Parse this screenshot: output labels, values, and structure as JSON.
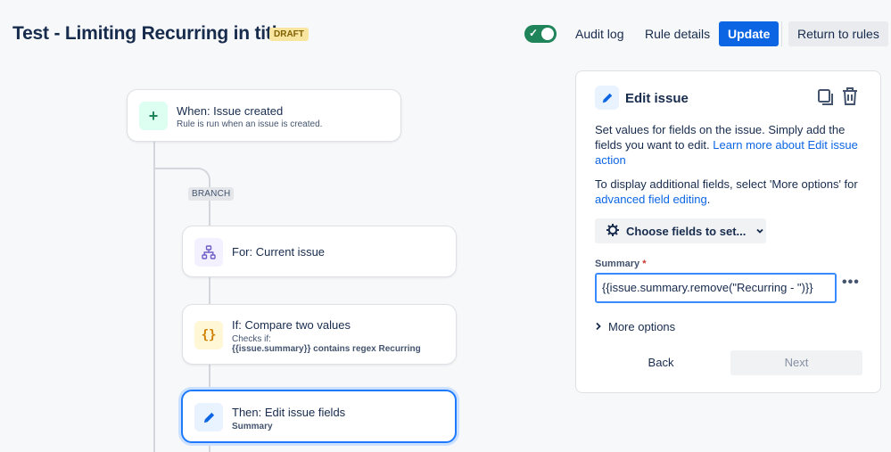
{
  "header": {
    "title": "Test - Limiting Recurring in title",
    "status_badge": "DRAFT",
    "enabled": true,
    "audit_log": "Audit log",
    "rule_details": "Rule details",
    "update": "Update",
    "return_to_rules": "Return to rules"
  },
  "flow": {
    "trigger": {
      "title": "When: Issue created",
      "subtitle": "Rule is run when an issue is created.",
      "icon": "plus-icon"
    },
    "branch_label": "BRANCH",
    "branch": {
      "title": "For: Current issue",
      "icon": "hierarchy-icon"
    },
    "condition": {
      "title": "If: Compare two values",
      "line1": "Checks if:",
      "line2": "{{issue.summary}} contains regex Recurring",
      "icon": "braces-icon"
    },
    "action": {
      "title": "Then: Edit issue fields",
      "subtitle": "Summary",
      "icon": "pencil-icon"
    }
  },
  "panel": {
    "title": "Edit issue",
    "description_part1": "Set values for fields on the issue. Simply add the fields you want to edit. ",
    "description_link": "Learn more about Edit issue action",
    "info_part1": "To display additional fields, select 'More options' for ",
    "info_link": "advanced field editing",
    "info_part2": ".",
    "choose_fields": "Choose fields to set...",
    "field_label": "Summary",
    "required_mark": "*",
    "field_value": "{{issue.summary.remove(\"Recurring - \")}}",
    "more_options": "More options",
    "back": "Back",
    "next": "Next"
  },
  "colors": {
    "primary": "#0c66e4",
    "toggle_on": "#1f845a",
    "draft_badge": "#f8e6a0"
  }
}
